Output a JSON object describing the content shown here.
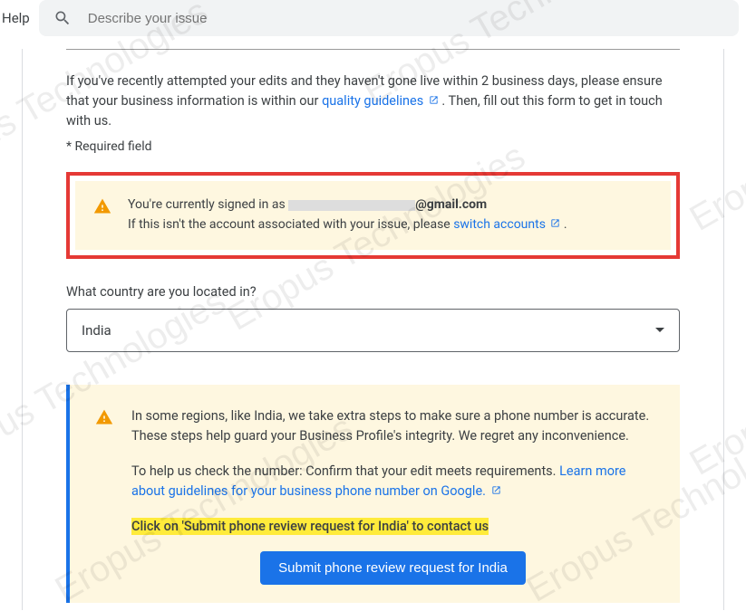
{
  "header": {
    "help_label": "Help",
    "search_placeholder": "Describe your issue"
  },
  "intro": {
    "text_before_link": "If you've recently attempted your edits and they haven't gone live within 2 business days, please ensure that your business information is within our ",
    "link_text": "quality guidelines",
    "text_after_link": " . Then, fill out this form to get in touch with us.",
    "required_note": "* Required field"
  },
  "signin_box": {
    "prefix": "You're currently signed in as",
    "email_visible": "@gmail.com",
    "switch_prefix": "If this isn't the account associated with your issue, please ",
    "switch_link": "switch accounts",
    "switch_suffix": " ."
  },
  "country": {
    "label": "What country are you located in?",
    "value": "India"
  },
  "info_panel": {
    "para1": "In some regions, like India, we take extra steps to make sure a phone number is accurate. These steps help guard your Business Profile's integrity. We regret any inconvenience.",
    "para2_before": "To help us check the number: Confirm that your edit meets requirements. ",
    "para2_link": "Learn more about guidelines for your business phone number on Google.",
    "highlight": "Click on 'Submit phone review request for India' to contact us",
    "button": "Submit phone review request for India"
  },
  "watermark_text": "Eropus Technologies"
}
